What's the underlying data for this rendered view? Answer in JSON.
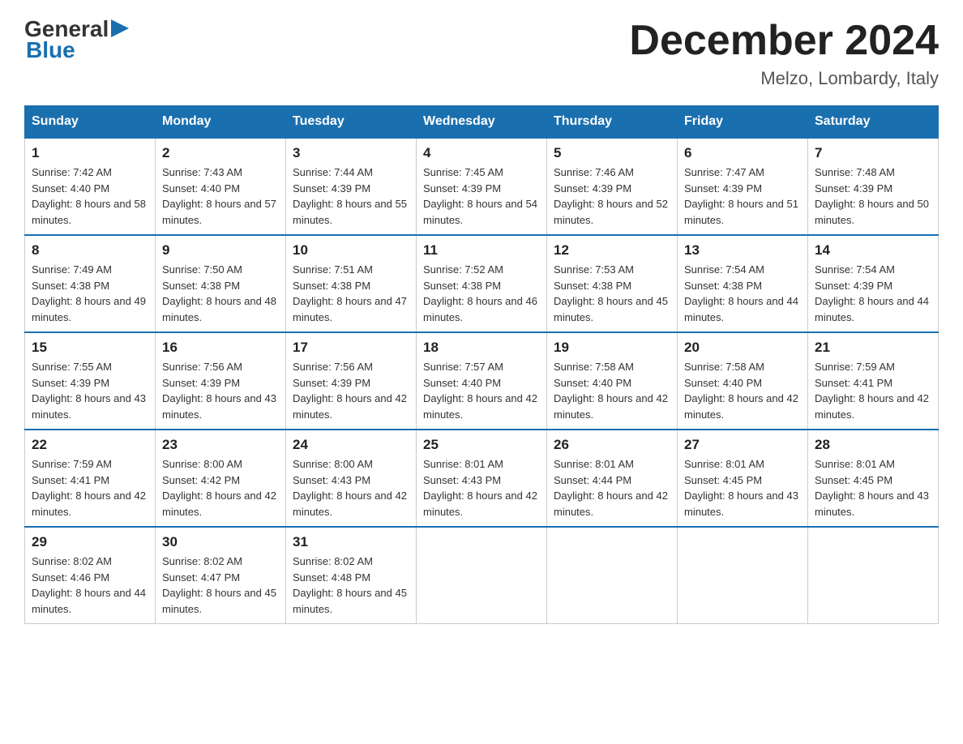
{
  "header": {
    "logo": {
      "general": "General",
      "blue": "Blue",
      "triangle": "▶"
    },
    "title": "December 2024",
    "subtitle": "Melzo, Lombardy, Italy"
  },
  "days_of_week": [
    "Sunday",
    "Monday",
    "Tuesday",
    "Wednesday",
    "Thursday",
    "Friday",
    "Saturday"
  ],
  "weeks": [
    [
      {
        "day": "1",
        "sunrise": "7:42 AM",
        "sunset": "4:40 PM",
        "daylight": "8 hours and 58 minutes."
      },
      {
        "day": "2",
        "sunrise": "7:43 AM",
        "sunset": "4:40 PM",
        "daylight": "8 hours and 57 minutes."
      },
      {
        "day": "3",
        "sunrise": "7:44 AM",
        "sunset": "4:39 PM",
        "daylight": "8 hours and 55 minutes."
      },
      {
        "day": "4",
        "sunrise": "7:45 AM",
        "sunset": "4:39 PM",
        "daylight": "8 hours and 54 minutes."
      },
      {
        "day": "5",
        "sunrise": "7:46 AM",
        "sunset": "4:39 PM",
        "daylight": "8 hours and 52 minutes."
      },
      {
        "day": "6",
        "sunrise": "7:47 AM",
        "sunset": "4:39 PM",
        "daylight": "8 hours and 51 minutes."
      },
      {
        "day": "7",
        "sunrise": "7:48 AM",
        "sunset": "4:39 PM",
        "daylight": "8 hours and 50 minutes."
      }
    ],
    [
      {
        "day": "8",
        "sunrise": "7:49 AM",
        "sunset": "4:38 PM",
        "daylight": "8 hours and 49 minutes."
      },
      {
        "day": "9",
        "sunrise": "7:50 AM",
        "sunset": "4:38 PM",
        "daylight": "8 hours and 48 minutes."
      },
      {
        "day": "10",
        "sunrise": "7:51 AM",
        "sunset": "4:38 PM",
        "daylight": "8 hours and 47 minutes."
      },
      {
        "day": "11",
        "sunrise": "7:52 AM",
        "sunset": "4:38 PM",
        "daylight": "8 hours and 46 minutes."
      },
      {
        "day": "12",
        "sunrise": "7:53 AM",
        "sunset": "4:38 PM",
        "daylight": "8 hours and 45 minutes."
      },
      {
        "day": "13",
        "sunrise": "7:54 AM",
        "sunset": "4:38 PM",
        "daylight": "8 hours and 44 minutes."
      },
      {
        "day": "14",
        "sunrise": "7:54 AM",
        "sunset": "4:39 PM",
        "daylight": "8 hours and 44 minutes."
      }
    ],
    [
      {
        "day": "15",
        "sunrise": "7:55 AM",
        "sunset": "4:39 PM",
        "daylight": "8 hours and 43 minutes."
      },
      {
        "day": "16",
        "sunrise": "7:56 AM",
        "sunset": "4:39 PM",
        "daylight": "8 hours and 43 minutes."
      },
      {
        "day": "17",
        "sunrise": "7:56 AM",
        "sunset": "4:39 PM",
        "daylight": "8 hours and 42 minutes."
      },
      {
        "day": "18",
        "sunrise": "7:57 AM",
        "sunset": "4:40 PM",
        "daylight": "8 hours and 42 minutes."
      },
      {
        "day": "19",
        "sunrise": "7:58 AM",
        "sunset": "4:40 PM",
        "daylight": "8 hours and 42 minutes."
      },
      {
        "day": "20",
        "sunrise": "7:58 AM",
        "sunset": "4:40 PM",
        "daylight": "8 hours and 42 minutes."
      },
      {
        "day": "21",
        "sunrise": "7:59 AM",
        "sunset": "4:41 PM",
        "daylight": "8 hours and 42 minutes."
      }
    ],
    [
      {
        "day": "22",
        "sunrise": "7:59 AM",
        "sunset": "4:41 PM",
        "daylight": "8 hours and 42 minutes."
      },
      {
        "day": "23",
        "sunrise": "8:00 AM",
        "sunset": "4:42 PM",
        "daylight": "8 hours and 42 minutes."
      },
      {
        "day": "24",
        "sunrise": "8:00 AM",
        "sunset": "4:43 PM",
        "daylight": "8 hours and 42 minutes."
      },
      {
        "day": "25",
        "sunrise": "8:01 AM",
        "sunset": "4:43 PM",
        "daylight": "8 hours and 42 minutes."
      },
      {
        "day": "26",
        "sunrise": "8:01 AM",
        "sunset": "4:44 PM",
        "daylight": "8 hours and 42 minutes."
      },
      {
        "day": "27",
        "sunrise": "8:01 AM",
        "sunset": "4:45 PM",
        "daylight": "8 hours and 43 minutes."
      },
      {
        "day": "28",
        "sunrise": "8:01 AM",
        "sunset": "4:45 PM",
        "daylight": "8 hours and 43 minutes."
      }
    ],
    [
      {
        "day": "29",
        "sunrise": "8:02 AM",
        "sunset": "4:46 PM",
        "daylight": "8 hours and 44 minutes."
      },
      {
        "day": "30",
        "sunrise": "8:02 AM",
        "sunset": "4:47 PM",
        "daylight": "8 hours and 45 minutes."
      },
      {
        "day": "31",
        "sunrise": "8:02 AM",
        "sunset": "4:48 PM",
        "daylight": "8 hours and 45 minutes."
      },
      null,
      null,
      null,
      null
    ]
  ]
}
